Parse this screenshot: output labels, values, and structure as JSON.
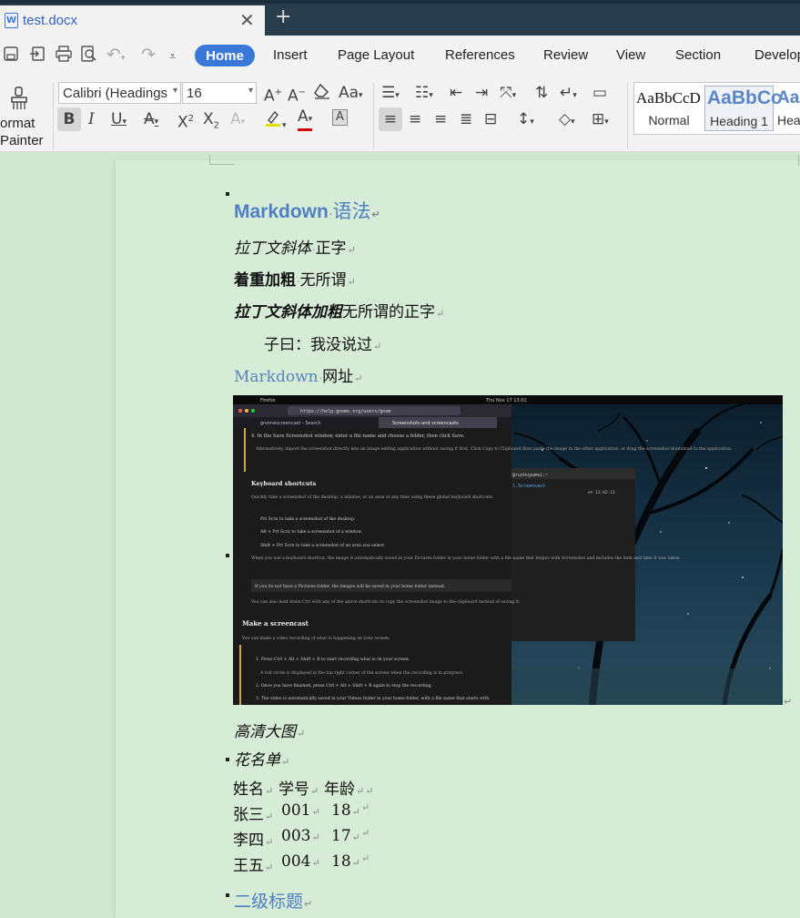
{
  "window": {
    "tab_title": "test.docx",
    "app_icon_letter": "W",
    "close_glyph": "✕",
    "new_tab_glyph": "+"
  },
  "quick_access": {
    "icons": [
      "save-icon",
      "export-icon",
      "print-icon",
      "print-preview-icon",
      "undo-icon",
      "redo-icon",
      "customize-icon"
    ]
  },
  "menu": {
    "items": [
      "Home",
      "Insert",
      "Page Layout",
      "References",
      "Review",
      "View",
      "Section",
      "Develop"
    ]
  },
  "toolbar": {
    "format_painter_line1": "ormat",
    "format_painter_line2": "Painter",
    "font_name": "Calibri (Headings",
    "font_size": "16",
    "styles": {
      "normal_sample": "AaBbCcD",
      "normal_label": "Normal",
      "heading1_sample": "AaBbCc",
      "heading1_label": "Heading 1",
      "heading2_sample": "AaBl",
      "heading2_label": "Hea"
    }
  },
  "document": {
    "heading1_latin": "Markdown",
    "heading1_cjk": "语法",
    "line1_italic": "拉丁文斜体",
    "line1_rest": "正字",
    "line2_bold": "着重加粗",
    "line2_rest": "无所谓",
    "line3_bolditalic": "拉丁文斜体加粗",
    "line3_rest": "无所谓的正字",
    "quote": "子曰：我没说过",
    "link_text": "Markdown",
    "link_rest": "网址",
    "caption": "高清大图",
    "list_title": "花名单",
    "table": {
      "header": [
        "姓名",
        "学号",
        "年龄"
      ],
      "rows": [
        [
          "张三",
          "001",
          "18"
        ],
        [
          "李四",
          "003",
          "17"
        ],
        [
          "王五",
          "004",
          "18"
        ]
      ]
    },
    "heading2": "二级标题",
    "para_mark": "↵"
  },
  "embedded_image": {
    "topbar_left": "Firefox",
    "topbar_clock": "Thu Nov 17 13:01",
    "url": "https://help.gnome.org/users/gnom",
    "tab1": "gnomescreencast - Search",
    "tab2": "Screenshots and screencasts",
    "step4": "4. In the Save Screenshot window, enter a file name and choose a folder, then click Save.",
    "alt_text": "Alternatively, import the screenshot directly into an image editing application without saving it first. Click Copy to Clipboard then paste the image in the other application, or drag the screenshot thumbnail to the application.",
    "kb_heading": "Keyboard shortcuts",
    "kb_intro": "Quickly take a screenshot of the desktop, a window, or an area at any time using these global keyboard shortcuts:",
    "kb1": "Prt Scrn  to take a screenshot of the desktop.",
    "kb2": "Alt + Prt Scrn  to take a screenshot of a window.",
    "kb3": "Shift + Prt Scrn  to take a screenshot of an area you select.",
    "kb_note": "When you use a keyboard shortcut, the image is automatically saved in your Pictures folder in your home folder with a file name that begins with Screenshot and includes the date and time it was taken.",
    "kb_tip": "If you do not have a Pictures folder, the images will be saved in your home folder instead.",
    "kb_ctrl": "You can also hold down Ctrl with any of the above shortcuts to copy the screenshot image to the clipboard instead of saving it.",
    "sc_heading": "Make a screencast",
    "sc_intro": "You can make a video recording of what is happening on your screen:",
    "sc1": "1. Press Ctrl + Alt + Shift + R to start recording what is on your screen.",
    "sc1b": "A red circle is displayed in the top right corner of the screen when the recording is in progress.",
    "sc2": "2. Once you have finished, press Ctrl + Alt + Shift + R again to stop the recording.",
    "sc3": "3. The video is automatically saved in your Videos folder in your home folder, with a file name that starts with",
    "term_title": "r@rushuyumei:~",
    "term_line": "ll.Screencast",
    "term_time": "et  13:02:11"
  }
}
